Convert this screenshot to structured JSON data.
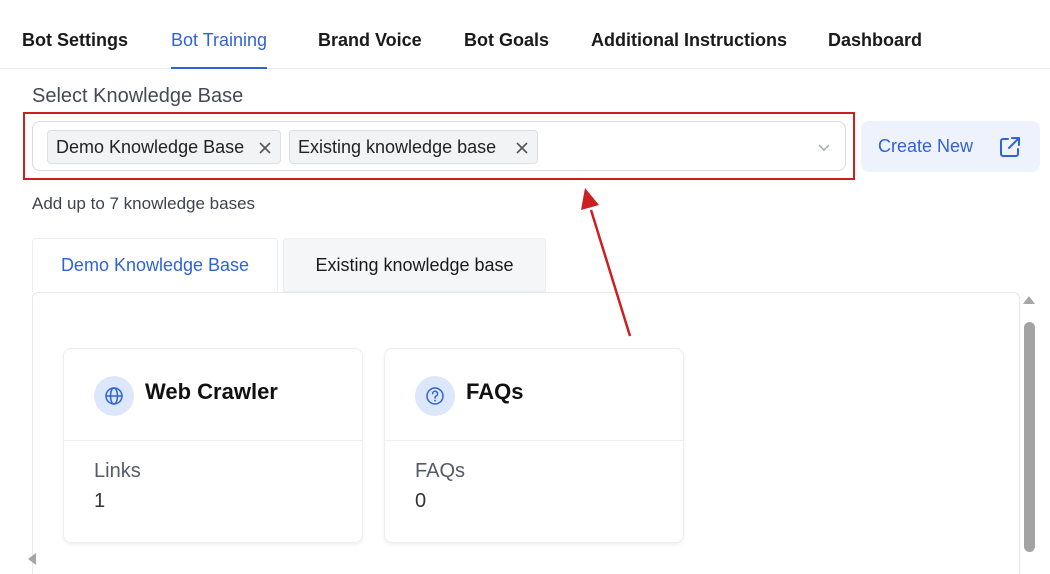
{
  "top_tabs": [
    {
      "label": "Bot Settings",
      "active": false
    },
    {
      "label": "Bot Training",
      "active": true
    },
    {
      "label": "Brand Voice",
      "active": false
    },
    {
      "label": "Bot Goals",
      "active": false
    },
    {
      "label": "Additional Instructions",
      "active": false
    },
    {
      "label": "Dashboard",
      "active": false
    }
  ],
  "knowledge_base": {
    "label": "Select Knowledge Base",
    "selected": [
      "Demo Knowledge Base",
      "Existing knowledge base"
    ],
    "helper": "Add up to 7 knowledge bases",
    "create_button": "Create New"
  },
  "kb_tabs": [
    {
      "label": "Demo Knowledge Base",
      "active": true
    },
    {
      "label": "Existing knowledge base",
      "active": false
    }
  ],
  "cards": [
    {
      "title": "Web Crawler",
      "icon": "globe-icon",
      "stat_label": "Links",
      "stat_value": "1"
    },
    {
      "title": "FAQs",
      "icon": "question-circle-icon",
      "stat_label": "FAQs",
      "stat_value": "0"
    }
  ],
  "colors": {
    "accent": "#2f63d6",
    "annotation": "#cc1f1f",
    "icon_bg": "#dce7fb"
  }
}
